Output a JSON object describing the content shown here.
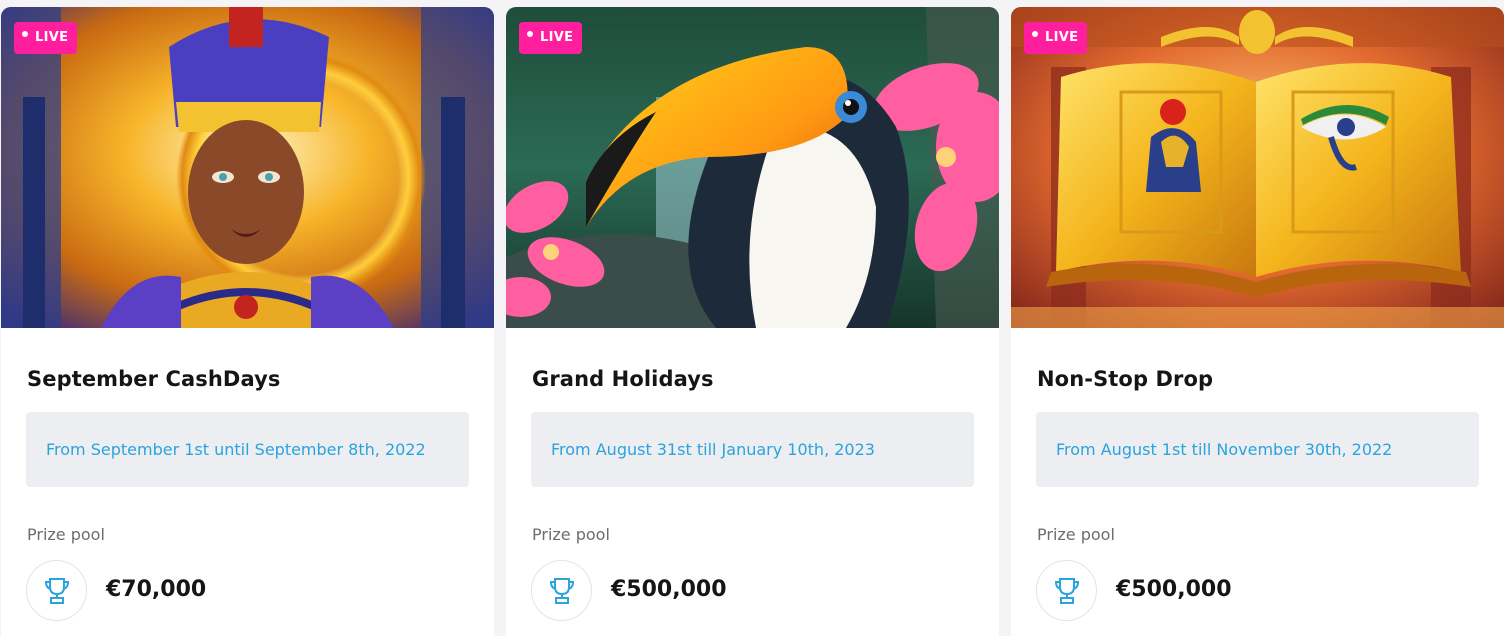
{
  "badge": {
    "live_label": "LIVE"
  },
  "colors": {
    "live_badge": "#ff1f9e",
    "date_text": "#2ba3dd",
    "date_box": "#eceef1",
    "trophy_icon": "#2ba3dd"
  },
  "tournaments": [
    {
      "title": "September CashDays",
      "dates": "From September 1st until September 8th, 2022",
      "prize_label": "Prize pool",
      "prize_amount": "€70,000",
      "banner_icon": "queen-portrait"
    },
    {
      "title": "Grand Holidays",
      "dates": "From August 31st till January 10th, 2023",
      "prize_label": "Prize pool",
      "prize_amount": "€500,000",
      "banner_icon": "toucan"
    },
    {
      "title": "Non-Stop Drop",
      "dates": "From August 1st till November 30th, 2022",
      "prize_label": "Prize pool",
      "prize_amount": "€500,000",
      "banner_icon": "golden-book"
    }
  ]
}
